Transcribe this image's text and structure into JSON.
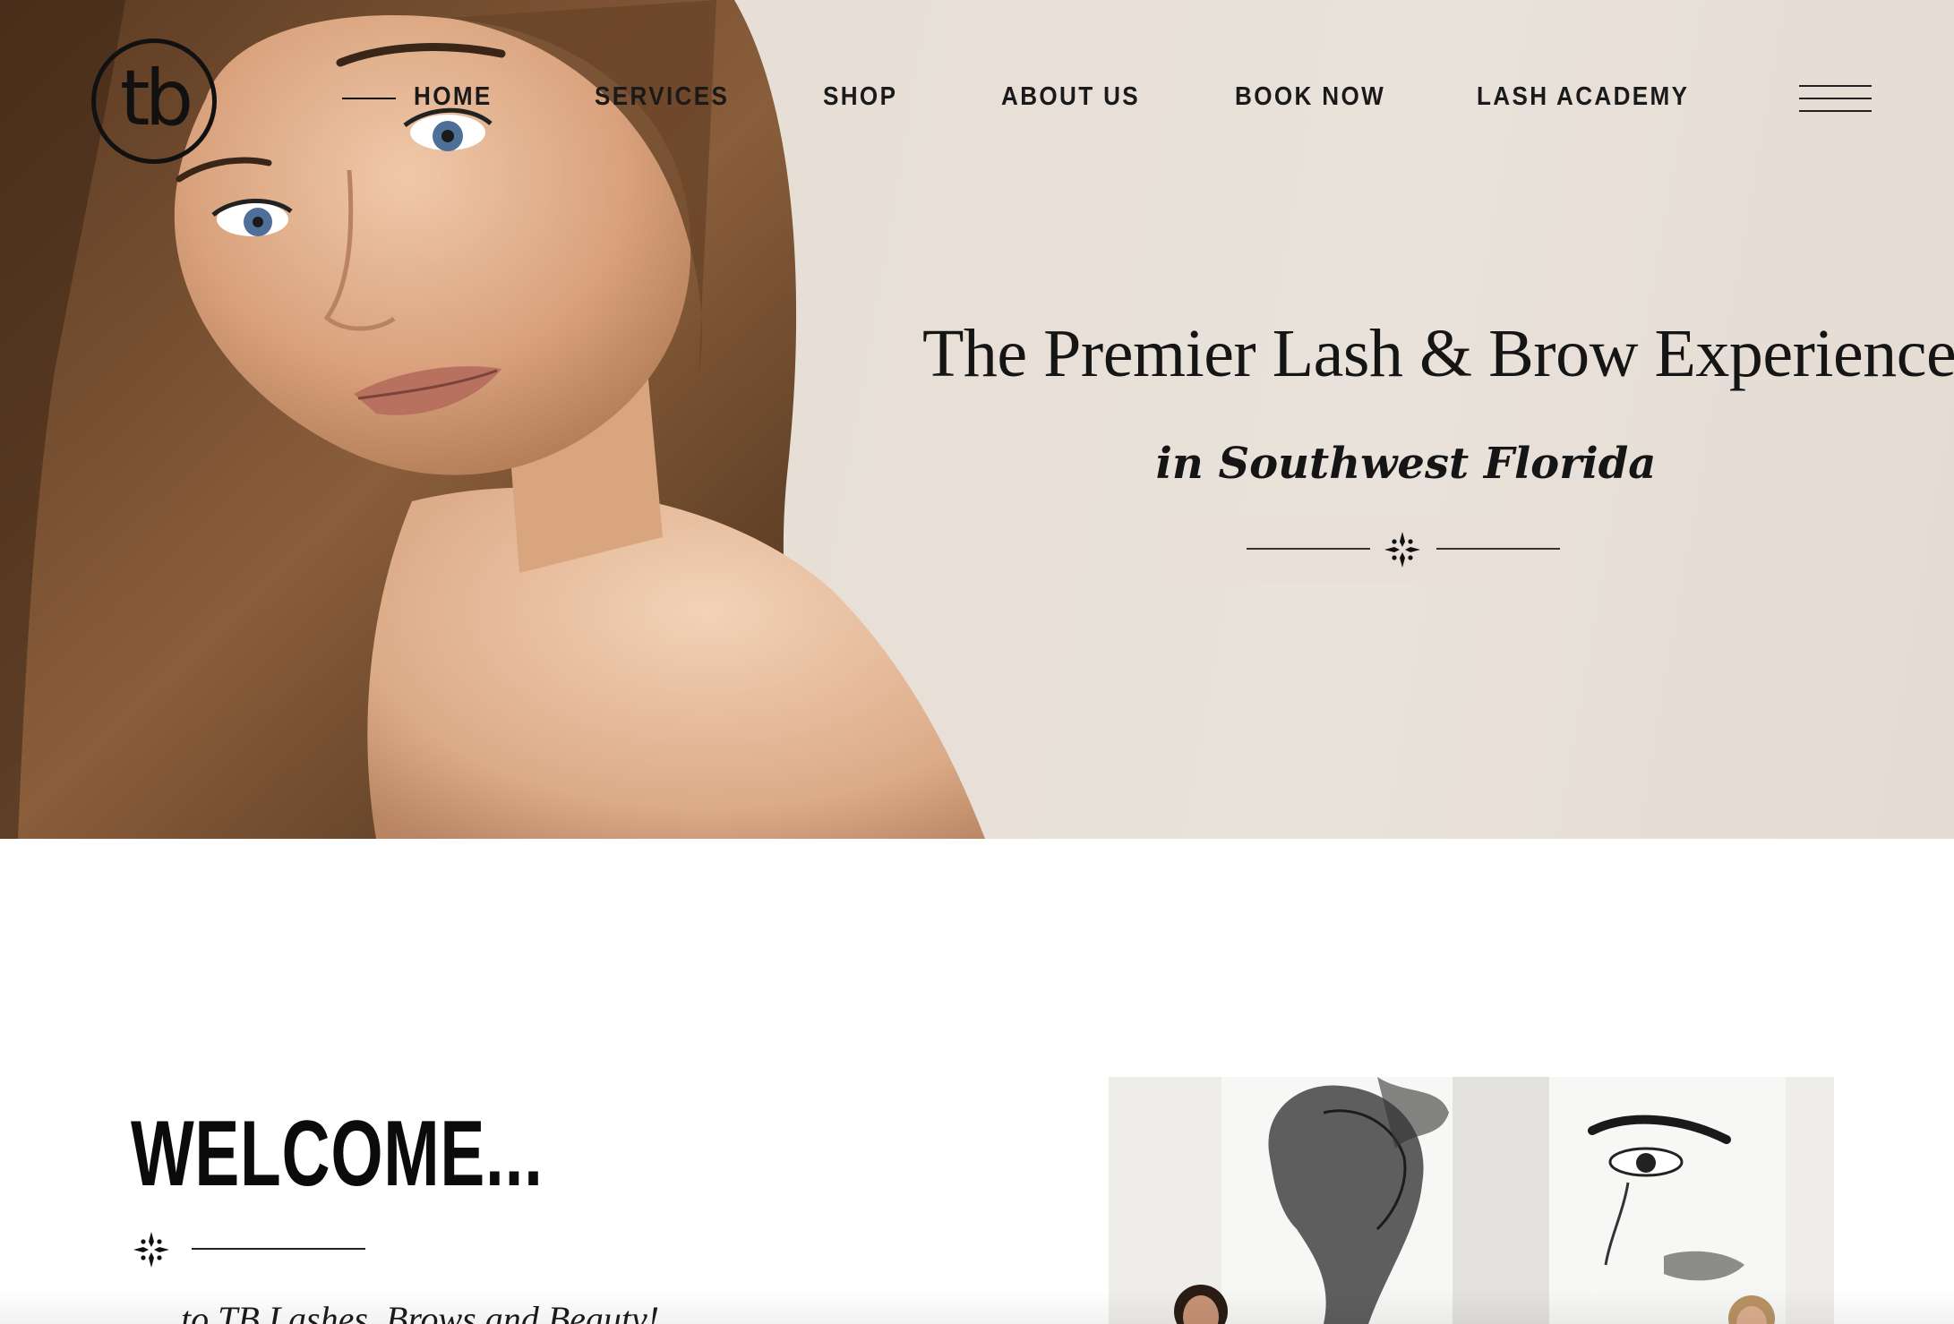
{
  "header": {
    "logo_text": "tb",
    "nav": [
      {
        "label": "HOME",
        "active": true
      },
      {
        "label": "SERVICES"
      },
      {
        "label": "SHOP"
      },
      {
        "label": "ABOUT US"
      },
      {
        "label": "BOOK NOW"
      },
      {
        "label": "LASH ACADEMY"
      }
    ],
    "menu_icon": "hamburger-menu-icon"
  },
  "hero": {
    "headline": "The Premier Lash & Brow Experience",
    "subheadline": "in Southwest Florida",
    "divider_icon": "sparkle-ornament-icon"
  },
  "welcome": {
    "title": "WELCOME...",
    "subtitle": "...to TB Lashes, Brows and Beauty!",
    "divider_icon": "sparkle-ornament-icon"
  },
  "colors": {
    "hero_background": "#e8e0d7",
    "text": "#111111",
    "page_background": "#ffffff"
  }
}
